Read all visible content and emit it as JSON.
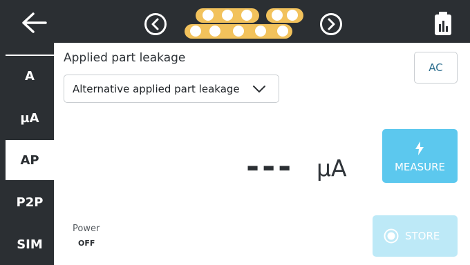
{
  "header": {
    "back_icon": "arrow-left-icon",
    "prev_icon": "chevron-left-circle-icon",
    "next_icon": "chevron-right-circle-icon",
    "report_icon": "clipboard-chart-icon",
    "progress_color": "#f2c25c"
  },
  "sidebar": {
    "items": [
      {
        "label": "A"
      },
      {
        "label": "µA"
      },
      {
        "label": "AP"
      },
      {
        "label": "P2P"
      },
      {
        "label": "SIM"
      }
    ],
    "active": "AP"
  },
  "main": {
    "title": "Applied part leakage",
    "dropdown_value": "Alternative applied part leakage",
    "ac_button": "AC",
    "reading": "---",
    "unit": "µA",
    "measure_button": "MEASURE",
    "store_button": "STORE",
    "power_label": "Power",
    "power_state": "OFF"
  },
  "colors": {
    "dark": "#2b2f33",
    "accent": "#5cc8ee",
    "accent_disabled": "#bde9f7"
  }
}
